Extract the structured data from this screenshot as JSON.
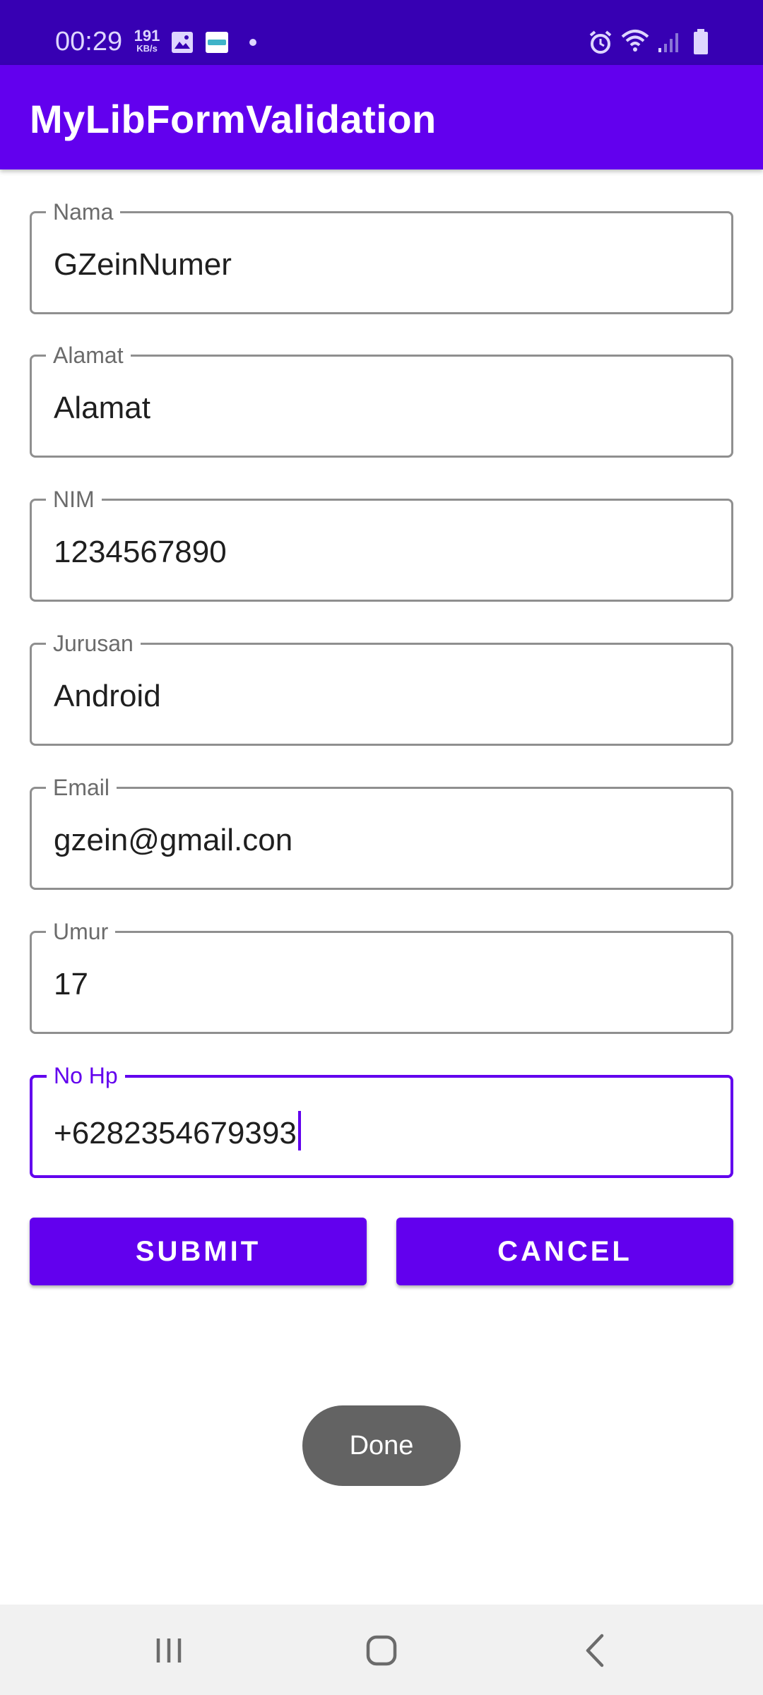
{
  "status_bar": {
    "time": "00:29",
    "speed_value": "191",
    "speed_unit": "KB/s",
    "left_icons": [
      "gallery-icon",
      "app-notification-icon",
      "dot-icon"
    ],
    "right_icons": [
      "alarm-icon",
      "wifi-icon",
      "signal-icon",
      "battery-icon"
    ],
    "color": "#3700B3"
  },
  "app_bar": {
    "title": "MyLibFormValidation",
    "color": "#6200EE"
  },
  "form": {
    "fields": [
      {
        "label": "Nama",
        "value": "GZeinNumer"
      },
      {
        "label": "Alamat",
        "value": "Alamat"
      },
      {
        "label": "NIM",
        "value": "1234567890"
      },
      {
        "label": "Jurusan",
        "value": "Android"
      },
      {
        "label": "Email",
        "value": "gzein@gmail.con"
      },
      {
        "label": "Umur",
        "value": "17"
      },
      {
        "label": "No Hp",
        "value": "+6282354679393",
        "focused": true
      }
    ],
    "submit_label": "SUBMIT",
    "cancel_label": "CANCEL"
  },
  "toast": {
    "text": "Done"
  },
  "nav_bar": {
    "icons": [
      "recents-icon",
      "home-icon",
      "back-icon"
    ]
  },
  "colors": {
    "primary": "#6200EE",
    "primary_dark": "#3700B3",
    "toast": "#636363"
  }
}
